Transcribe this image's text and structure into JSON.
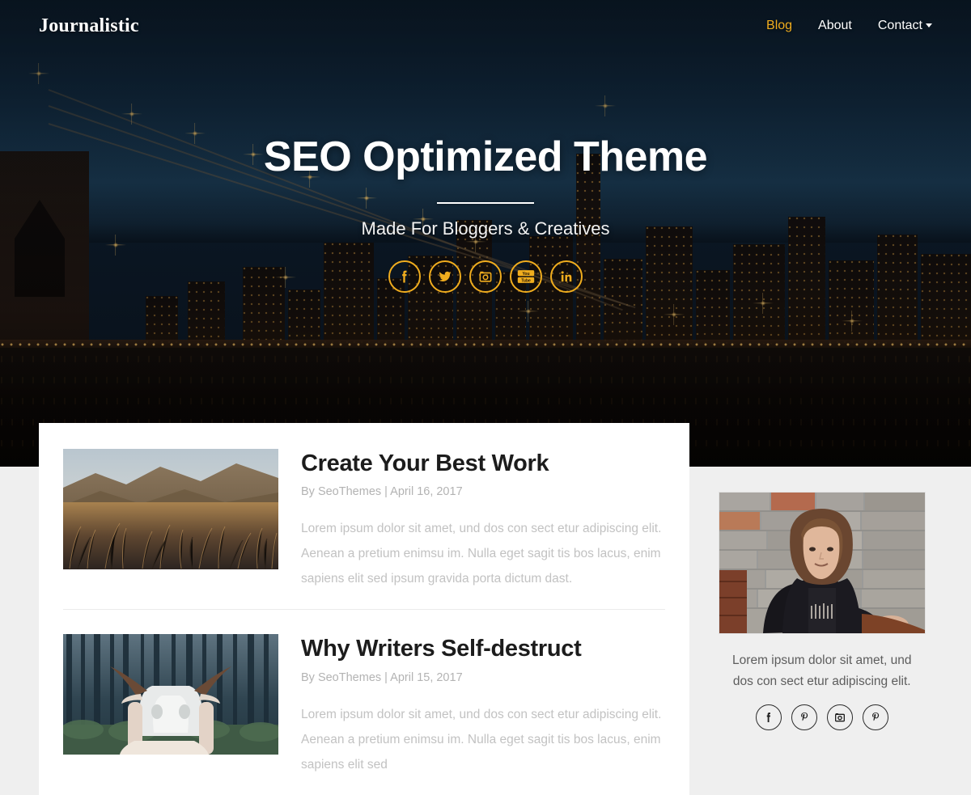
{
  "site": {
    "brand": "Journalistic",
    "accent_color": "#f0ad1e",
    "nav_active_color": "#f0ad1e",
    "hero_bg_color": "#0d1b2a",
    "page_bg_color": "#efefef"
  },
  "nav": {
    "items": [
      {
        "label": "Blog",
        "active": true,
        "caret": false
      },
      {
        "label": "About",
        "active": false,
        "caret": false
      },
      {
        "label": "Contact",
        "active": false,
        "caret": true
      }
    ]
  },
  "hero": {
    "title": "SEO Optimized Theme",
    "subtitle": "Made For Bloggers & Creatives",
    "social": [
      {
        "name": "facebook-icon",
        "label": "Facebook"
      },
      {
        "name": "twitter-icon",
        "label": "Twitter"
      },
      {
        "name": "instagram-icon",
        "label": "Instagram"
      },
      {
        "name": "youtube-icon",
        "label": "YouTube"
      },
      {
        "name": "linkedin-icon",
        "label": "LinkedIn"
      }
    ]
  },
  "posts": [
    {
      "title": "Create Your Best Work",
      "meta": "By SeoThemes | April 16, 2017",
      "excerpt": "Lorem ipsum dolor sit amet, und dos con sect etur adipiscing elit. Aenean a pretium enimsu im. Nulla eget sagit tis bos lacus, enim sapiens elit sed ipsum gravida porta dictum dast.",
      "image_alt": "golden-grass-mountain-landscape"
    },
    {
      "title": "Why Writers Self-destruct",
      "meta": "By SeoThemes | April 15, 2017",
      "excerpt": "Lorem ipsum dolor sit amet, und dos con sect etur adipiscing elit. Aenean a pretium enimsu im. Nulla eget sagit tis bos lacus, enim sapiens elit sed",
      "image_alt": "person-holding-bull-skull-in-forest"
    }
  ],
  "sidebar": {
    "author_image_alt": "woman-against-brick-wall",
    "text": "Lorem ipsum dolor sit amet, und dos con sect etur adipiscing elit.",
    "social": [
      {
        "name": "facebook-icon",
        "label": "Facebook"
      },
      {
        "name": "pinterest-icon",
        "label": "Pinterest"
      },
      {
        "name": "instagram-icon",
        "label": "Instagram"
      },
      {
        "name": "pinterest-icon",
        "label": "Pinterest"
      }
    ]
  }
}
